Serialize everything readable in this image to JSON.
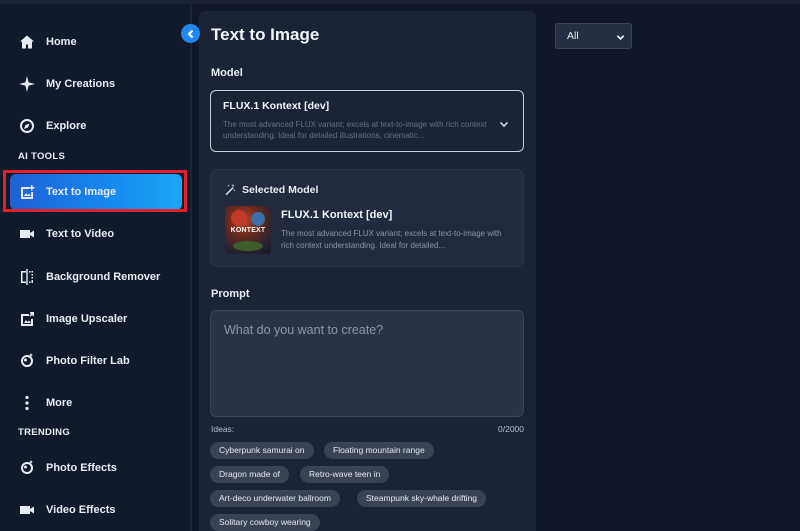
{
  "sidebar": {
    "items": [
      {
        "label": "Home",
        "icon": "home-icon"
      },
      {
        "label": "My Creations",
        "icon": "sparkle-icon"
      },
      {
        "label": "Explore",
        "icon": "compass-icon"
      }
    ],
    "ai_tools_label": "AI TOOLS",
    "ai_tools": [
      {
        "label": "Text to Image",
        "icon": "image-plus-icon",
        "active": true
      },
      {
        "label": "Text to Video",
        "icon": "video-icon"
      },
      {
        "label": "Background Remover",
        "icon": "background-remover-icon"
      },
      {
        "label": "Image Upscaler",
        "icon": "image-upscale-icon"
      },
      {
        "label": "Photo Filter Lab",
        "icon": "filter-lab-icon"
      },
      {
        "label": "More",
        "icon": "more-vertical-icon"
      }
    ],
    "trending_label": "TRENDING",
    "trending": [
      {
        "label": "Photo Effects",
        "icon": "photo-effects-icon"
      },
      {
        "label": "Video Effects",
        "icon": "video-effects-icon"
      }
    ]
  },
  "panel": {
    "title": "Text to Image",
    "model_label": "Model",
    "model_select": {
      "name": "FLUX.1 Kontext [dev]",
      "description": "The most advanced FLUX variant; excels at text-to-image with rich context understanding. Ideal for detailed illustrations, cinematic..."
    },
    "selected_model": {
      "heading": "Selected Model",
      "thumb_text": "KONTEXT",
      "name": "FLUX.1 Kontext [dev]",
      "description": "The most advanced FLUX variant; excels at text-to-image with rich context understanding. Ideal for detailed..."
    },
    "prompt_label": "Prompt",
    "prompt_placeholder": "What do you want to create?",
    "ideas_label": "Ideas:",
    "char_counter": "0/2000",
    "ideas": [
      "Cyberpunk samurai on",
      "Floating mountain range",
      "Dragon made of",
      "Retro-wave teen in",
      "Art-deco underwater ballroom",
      "Steampunk sky-whale drifting",
      "Solitary cowboy wearing"
    ]
  },
  "filter": {
    "selected": "All"
  },
  "colors": {
    "accent": "#1e88f0",
    "highlight_outline": "#e3202e",
    "panel_bg": "#1b2435",
    "page_bg": "#0f1729"
  }
}
